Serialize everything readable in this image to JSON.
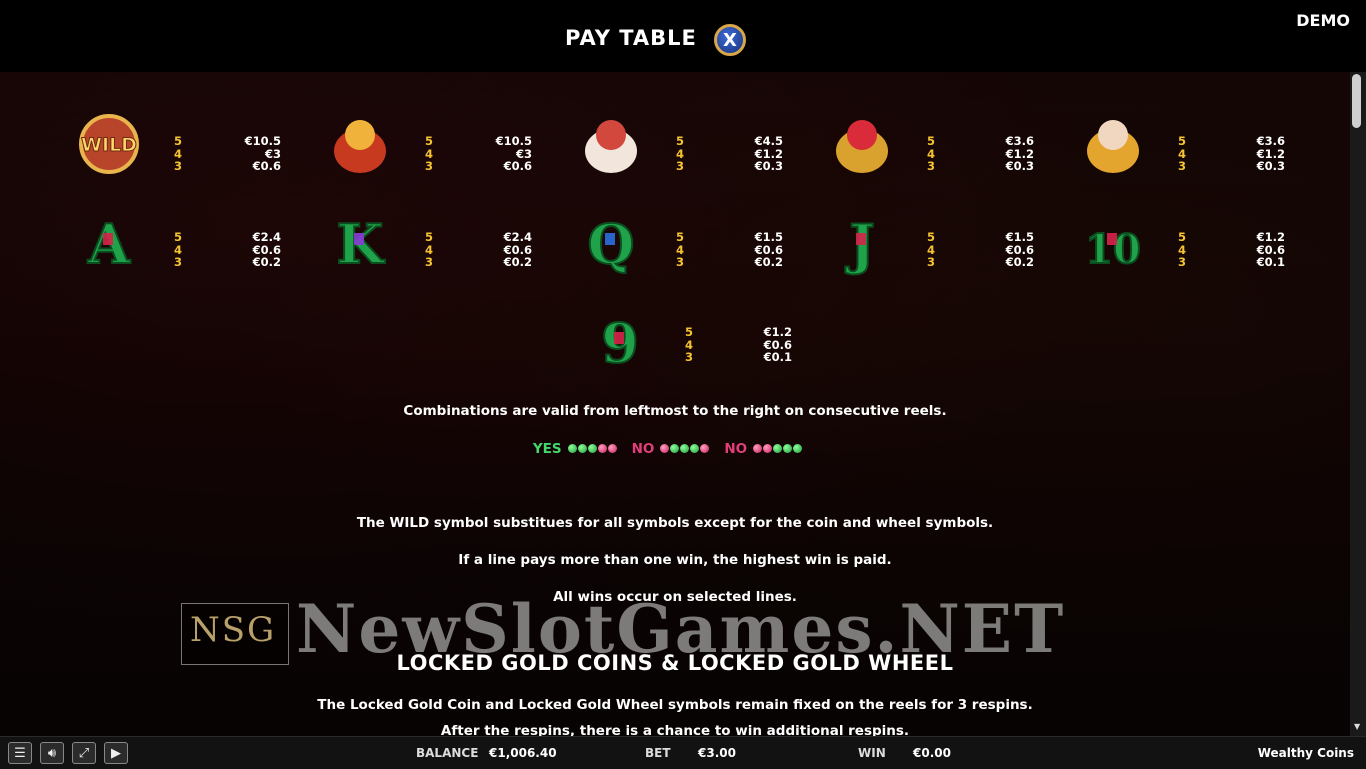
{
  "header": {
    "title": "PAY TABLE",
    "close_label": "X",
    "demo_label": "DEMO"
  },
  "paytable": {
    "multipliers": [
      "5",
      "4",
      "3"
    ],
    "rows": [
      [
        {
          "symbol": "wild",
          "label": "WILD",
          "pays": [
            "€10.5",
            "€3",
            "€0.6"
          ]
        },
        {
          "symbol": "god-of-wealth",
          "pays": [
            "€10.5",
            "€3",
            "€0.6"
          ]
        },
        {
          "symbol": "lion",
          "pays": [
            "€4.5",
            "€1.2",
            "€0.3"
          ]
        },
        {
          "symbol": "toad-girl",
          "pays": [
            "€3.6",
            "€1.2",
            "€0.3"
          ]
        },
        {
          "symbol": "fish-boy",
          "pays": [
            "€3.6",
            "€1.2",
            "€0.3"
          ]
        }
      ],
      [
        {
          "symbol": "A",
          "label": "A",
          "pays": [
            "€2.4",
            "€0.6",
            "€0.2"
          ]
        },
        {
          "symbol": "K",
          "label": "K",
          "pays": [
            "€2.4",
            "€0.6",
            "€0.2"
          ]
        },
        {
          "symbol": "Q",
          "label": "Q",
          "pays": [
            "€1.5",
            "€0.6",
            "€0.2"
          ]
        },
        {
          "symbol": "J",
          "label": "J",
          "pays": [
            "€1.5",
            "€0.6",
            "€0.2"
          ]
        },
        {
          "symbol": "10",
          "label": "10",
          "pays": [
            "€1.2",
            "€0.6",
            "€0.1"
          ]
        }
      ],
      [
        {
          "symbol": "9",
          "label": "9",
          "pays": [
            "€1.2",
            "€0.6",
            "€0.1"
          ]
        }
      ]
    ]
  },
  "rules": {
    "combinations": "Combinations are valid from leftmost to the right on consecutive reels.",
    "yes_label": "YES",
    "no_label": "NO",
    "examples": [
      {
        "label": "YES",
        "dots": [
          "g",
          "g",
          "g",
          "p",
          "p"
        ]
      },
      {
        "label": "NO",
        "dots": [
          "p",
          "g",
          "g",
          "g",
          "p"
        ]
      },
      {
        "label": "NO",
        "dots": [
          "p",
          "p",
          "g",
          "g",
          "g"
        ]
      }
    ],
    "wild_text": "The WILD symbol substitues for all symbols except for the coin and wheel symbols.",
    "line_text": "If a line pays more than one win, the highest win is paid.",
    "lines_text": "All wins occur on selected lines."
  },
  "locked": {
    "title": "LOCKED GOLD COINS & LOCKED GOLD WHEEL",
    "text1": "The Locked Gold Coin and Locked Gold Wheel symbols remain fixed on the reels for 3 respins.",
    "text2": "After the respins, there is a chance to win additional respins."
  },
  "watermark": {
    "box_letters": "NSG",
    "text": "NewSlotGames.NET"
  },
  "footer": {
    "balance_label": "BALANCE",
    "balance_value": "€1,006.40",
    "bet_label": "BET",
    "bet_value": "€3.00",
    "win_label": "WIN",
    "win_value": "€0.00",
    "game_name": "Wealthy Coins"
  },
  "colors": {
    "multiplier": "#f6c431",
    "yes": "#43d86b",
    "no": "#e23f7a",
    "symbol_green": "#1fa24a",
    "gold": "#d9a64a"
  }
}
